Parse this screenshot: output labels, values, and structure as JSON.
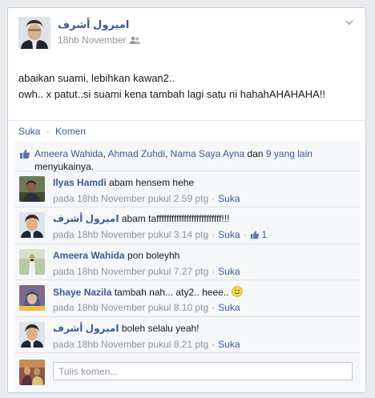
{
  "post": {
    "author": "اميرول أشرف",
    "timestamp": "18hb November",
    "privacy_icon": "friends-icon",
    "lines": [
      "abaikan suami, lebihkan kawan2..",
      "owh.. x patut..si suami kena tambah lagi satu ni hahahAHAHAHA!!"
    ]
  },
  "actions": {
    "like": "Suka",
    "separator": "·",
    "comment": "Komen"
  },
  "likes": {
    "names": [
      "Ameera Wahida",
      "Ahmad Zuhdi",
      "Nama Saya Ayna"
    ],
    "comma": ",",
    "and": "dan",
    "others": "9 yang lain",
    "suffix": "menyukainya."
  },
  "comments": [
    {
      "name": "Ilyas Hamdi",
      "text": "abam hensem hehe",
      "time": "pada 18hb November pukul 2.59 ptg",
      "like_label": "Suka"
    },
    {
      "name": "اميرول أشرف",
      "text": "abam taffffffffffffffffffffffffff!!!",
      "time": "pada 18hb November pukul 3.14 ptg",
      "like_label": "Suka",
      "like_count": "1"
    },
    {
      "name": "Ameera Wahida",
      "text": "pon boleyhh",
      "time": "pada 18hb November pukul 7.27 ptg",
      "like_label": "Suka"
    },
    {
      "name": "Shaye Nazila",
      "text": "tambah nah... aty2.. heee..",
      "time": "pada 18hb November pukul 8.10 ptg",
      "like_label": "Suka"
    },
    {
      "name": "اميرول أشرف",
      "text": "boleh selalu yeah!",
      "time": "pada 18hb November pukul 8.21 ptg",
      "like_label": "Suka"
    }
  ],
  "composer": {
    "placeholder": "Tulis komen..."
  },
  "colors": {
    "link": "#3b5998",
    "meta": "#90949c",
    "feedback_bg": "#f6f7f9"
  }
}
